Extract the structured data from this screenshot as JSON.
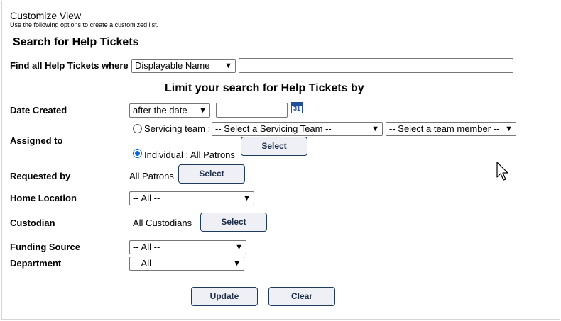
{
  "header": {
    "title": "Customize View",
    "subtitle": "Use the following options to create a customized list.",
    "heading": "Search for Help Tickets"
  },
  "find": {
    "label": "Find all Help Tickets where",
    "field_select": "Displayable Name",
    "value": ""
  },
  "limit_heading": "Limit your search for Help Tickets by",
  "date_created": {
    "label": "Date Created",
    "operator": "after the date",
    "value": "",
    "calendar_day": "31"
  },
  "assigned_to": {
    "label": "Assigned to",
    "servicing_team_label": "Servicing team :",
    "team_select": "-- Select a Servicing Team --",
    "member_select": "-- Select a team member --",
    "individual_label": "Individual : All Patrons",
    "select_button": "Select"
  },
  "requested_by": {
    "label": "Requested by",
    "value": "All Patrons",
    "select_button": "Select"
  },
  "home_location": {
    "label": "Home Location",
    "select": "-- All --"
  },
  "custodian": {
    "label": "Custodian",
    "value": "All Custodians",
    "select_button": "Select"
  },
  "funding_source": {
    "label": "Funding Source",
    "select": "-- All --"
  },
  "department": {
    "label": "Department",
    "select": "-- All --"
  },
  "actions": {
    "update": "Update",
    "clear": "Clear"
  },
  "icons": {
    "chevron": "chevron-down-icon",
    "calendar": "calendar-icon",
    "cursor": "mouse-pointer-icon"
  }
}
